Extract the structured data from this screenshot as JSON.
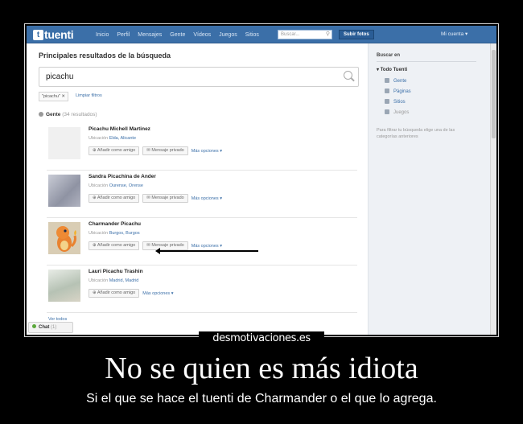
{
  "app": {
    "logo_mark": "t",
    "logo_text": "tuenti",
    "nav": [
      "Inicio",
      "Perfil",
      "Mensajes",
      "Gente",
      "Vídeos",
      "Juegos",
      "Sitios"
    ],
    "search_placeholder": "Buscar...",
    "upload_label": "Subir fotos",
    "user_menu": "Mi cuenta ▾"
  },
  "main": {
    "title": "Principales resultados de la búsqueda",
    "query": "picachu",
    "filter_tag": "\"picachu\" ✕",
    "clear_filters": "Limpiar filtros",
    "people_label": "Gente",
    "people_count": "(34 resultados)",
    "location_label": "Ubicación",
    "add_friend_label": "Añadir como amigo",
    "private_message_label": "Mensaje privado",
    "more_options_label": "Más opciones ▾",
    "results": [
      {
        "name": "Picachu Michell Martinez",
        "location": "Elda, Alicante",
        "avatar": "blank"
      },
      {
        "name": "Sandra Picachina de Ander",
        "location": "Ourense, Orense",
        "avatar": "gray"
      },
      {
        "name": "Charmander Picachu",
        "location": "Burgos, Burgos",
        "avatar": "charm"
      },
      {
        "name": "Lauri Picachu Trashin",
        "location": "Madrid, Madrid",
        "avatar": "girl"
      }
    ],
    "see_all": "Ver todos",
    "chat_label": "Chat",
    "chat_count": "(1)"
  },
  "sidebar": {
    "title": "Buscar en",
    "all": "Todo Tuenti",
    "items": [
      {
        "label": "Gente",
        "icon": "person-icon"
      },
      {
        "label": "Páginas",
        "icon": "pages-icon"
      },
      {
        "label": "Sitios",
        "icon": "place-icon"
      },
      {
        "label": "Juegos",
        "icon": "games-icon"
      }
    ],
    "hint": "Para filtrar tu búsqueda elige una de las categorías anteriores"
  },
  "caption": {
    "brand": "desmotivaciones.es",
    "title": "No se quien es más idiota",
    "subtitle": "Si el que se hace el tuenti de Charmander o el que lo agrega."
  }
}
